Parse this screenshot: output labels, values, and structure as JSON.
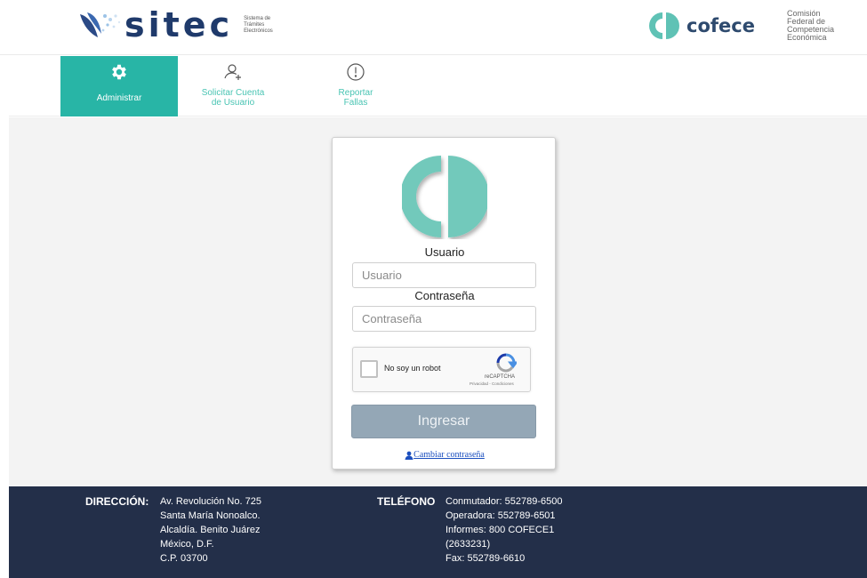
{
  "header": {
    "sitec_name": "sitec",
    "sitec_subtitle": [
      "Sistema de",
      "Trámites",
      "Electrónicos"
    ],
    "cofece_name": "cofece",
    "cofece_subtitle": [
      "Comisión",
      "Federal de",
      "Competencia",
      "Económica"
    ]
  },
  "nav": {
    "items": [
      {
        "label": "Administrar",
        "icon": "gear-icon",
        "active": true
      },
      {
        "label_lines": [
          "Solicitar Cuenta",
          "de Usuario"
        ],
        "icon": "add-user-icon"
      },
      {
        "label_lines": [
          "Reportar",
          "Fallas"
        ],
        "icon": "alert-icon"
      }
    ]
  },
  "login": {
    "user_label": "Usuario",
    "user_placeholder": "Usuario",
    "password_label": "Contraseña",
    "password_placeholder": "Contraseña",
    "captcha_text": "No soy un robot",
    "captcha_brand": "reCAPTCHA",
    "captcha_terms": "Privacidad - Condiciones",
    "submit_label": "Ingresar",
    "change_password": "Cambiar contraseña"
  },
  "footer": {
    "address_label": "DIRECCIÓN:",
    "address_lines": [
      "Av. Revolución No. 725",
      "Santa María Nonoalco.",
      "Alcaldía. Benito Juárez",
      "México, D.F.",
      "C.P. 03700"
    ],
    "phone_label": "TELÉFONO",
    "phone_lines": [
      "Conmutador: 552789-6500",
      "Operadora: 552789-6501",
      "Informes: 800 COFECE1",
      "(2633231)",
      "Fax: 552789-6610"
    ]
  },
  "colors": {
    "teal": "#28b5a6",
    "navy": "#232f49",
    "button": "#94a7b6"
  }
}
